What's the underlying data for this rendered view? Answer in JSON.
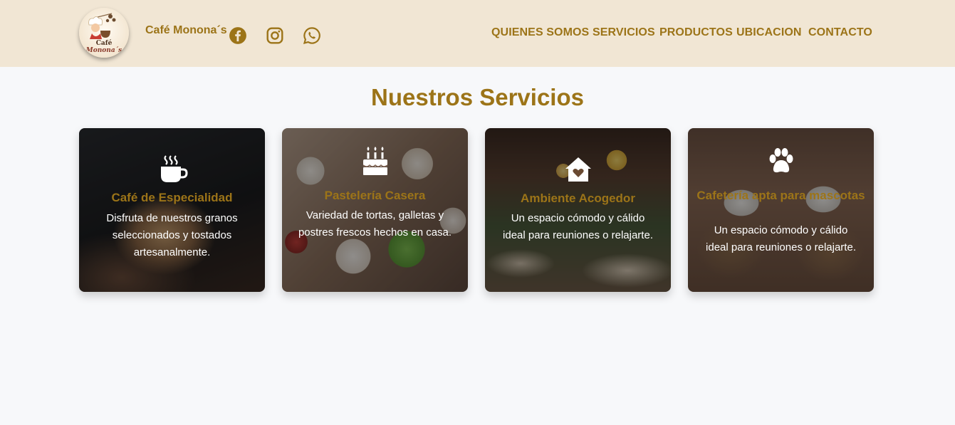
{
  "header": {
    "brand": "Café Monona´s",
    "logo": {
      "line1": "Café",
      "line2": "Monona´s"
    },
    "social": [
      {
        "icon": "facebook-icon"
      },
      {
        "icon": "instagram-icon"
      },
      {
        "icon": "whatsapp-icon"
      }
    ],
    "nav": [
      "QUIENES SOMOS",
      "SERVICIOS",
      "PRODUCTOS",
      "UBICACION",
      "CONTACTO"
    ]
  },
  "services": {
    "title": "Nuestros Servicios",
    "cards": [
      {
        "icon": "coffee-cup-icon",
        "title": "Café de Especialidad",
        "desc": "Disfruta de nuestros granos seleccionados y tostados artesanalmente."
      },
      {
        "icon": "birthday-cake-icon",
        "title": "Pastelería Casera",
        "desc": "Variedad de tortas, galletas y postres frescos hechos en casa."
      },
      {
        "icon": "house-heart-icon",
        "title": "Ambiente Acogedor",
        "desc": "Un espacio cómodo y cálido ideal para reuniones o relajarte."
      },
      {
        "icon": "paw-icon",
        "title": "Cafetería apta para mascotas",
        "desc": "Un espacio cómodo y cálido ideal para reuniones o relajarte."
      }
    ]
  },
  "colors": {
    "accent": "#9c7418",
    "header_bg": "#f1e6d4",
    "page_bg": "#f7f8fa"
  }
}
